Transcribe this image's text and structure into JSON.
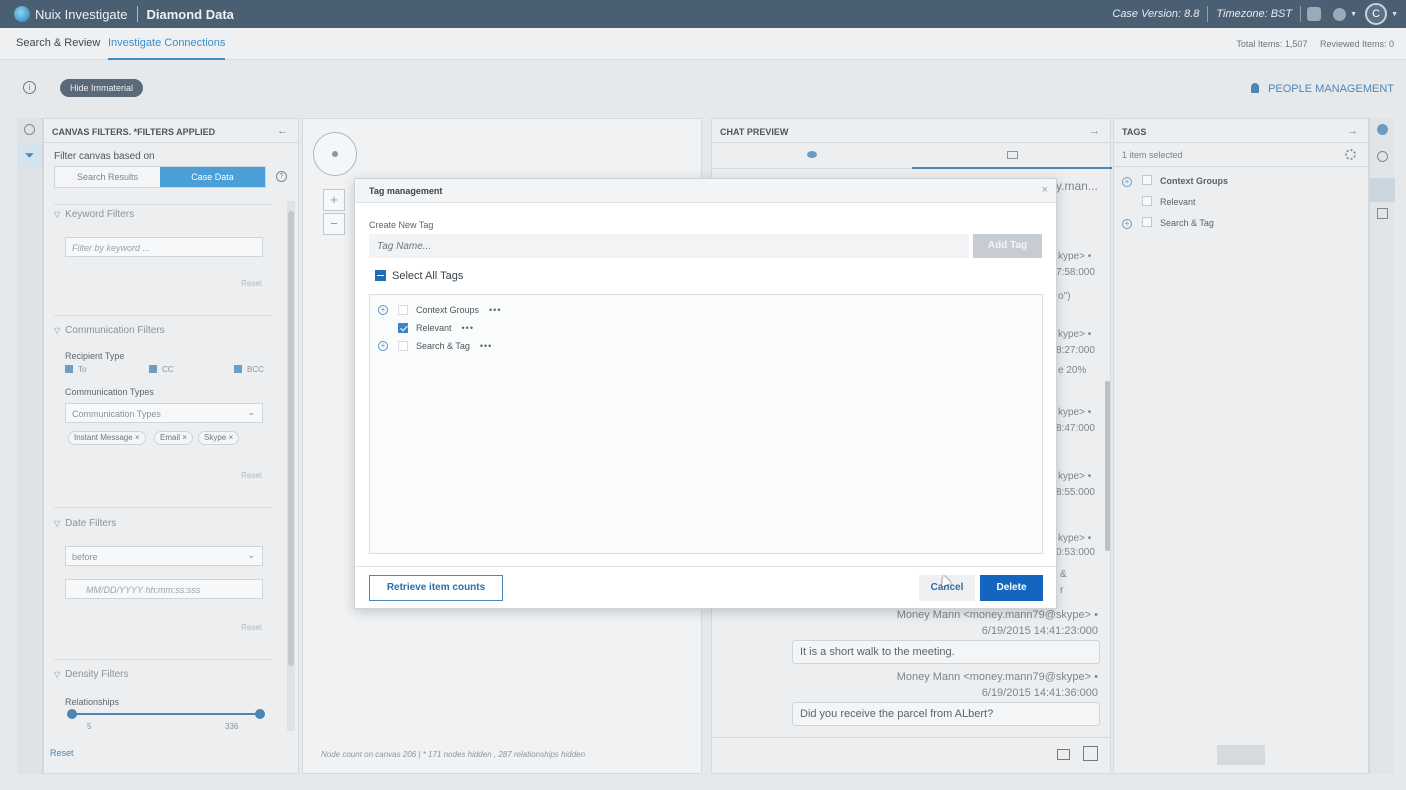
{
  "app": {
    "name": "Nuix Investigate",
    "case_name": "Diamond Data",
    "case_version": "Case Version: 8.8",
    "timezone": "Timezone: BST",
    "user_initial": "C"
  },
  "tabs": [
    {
      "label": "Search & Review"
    },
    {
      "label": "Investigate Connections",
      "active": true
    }
  ],
  "totals": {
    "total_items": "Total Items: 1,507",
    "reviewed_items": "Reviewed Items: 0"
  },
  "toolbar": {
    "hide_immaterial": "Hide Immaterial",
    "people_management": "PEOPLE MANAGEMENT"
  },
  "filters_panel": {
    "title": "CANVAS FILTERS. *FILTERS APPLIED",
    "filter_based_on": "Filter canvas based on",
    "segments": [
      "Search Results",
      "Case Data"
    ],
    "keyword_section": "Keyword Filters",
    "keyword_placeholder": "Filter by keyword ...",
    "reset": "Reset",
    "communication_section": "Communication Filters",
    "recipient_type": "Recipient Type",
    "recipients": [
      "To",
      "CC",
      "BCC"
    ],
    "communication_types_label": "Communication Types",
    "communication_types_placeholder": "Communication Types",
    "chips": [
      "Instant Message ×",
      "Email ×",
      "Skype ×"
    ],
    "date_section": "Date Filters",
    "date_mode": "before",
    "date_placeholder": "MM/DD/YYYY hh:mm:ss:sss",
    "density_section": "Density Filters",
    "relationships": "Relationships",
    "slider_min": "5",
    "slider_max": "336",
    "footer_reset": "Reset"
  },
  "canvas": {
    "zoom_in": "+",
    "zoom_out": "−",
    "footer": "Node count on canvas 206 | * 171 nodes hidden , 287 relationships hidden"
  },
  "chat_preview": {
    "title": "CHAT PREVIEW",
    "fragments": [
      "y.man...",
      "kype> •",
      "7:58:000",
      "o\")",
      "kype> •",
      "8:27:000",
      "e 20%",
      "kype> •",
      "8:47:000",
      "kype> •",
      "8:55:000",
      "kype> •",
      "0:53:000",
      "&",
      "r"
    ],
    "messages": [
      {
        "sender": "Money Mann <money.mann79@skype> •",
        "time": "6/19/2015 14:41:23:000",
        "text": "It is a short walk to the meeting."
      },
      {
        "sender": "Money Mann <money.mann79@skype> •",
        "time": "6/19/2015 14:41:36:000",
        "text": "Did you receive the parcel from ALbert?"
      }
    ]
  },
  "tags_panel": {
    "title": "TAGS",
    "selected": "1 item selected",
    "items": [
      "Context Groups",
      "Relevant",
      "Search & Tag"
    ]
  },
  "modal": {
    "title": "Tag management",
    "create_label": "Create New Tag",
    "tag_name_placeholder": "Tag Name...",
    "add_tag": "Add Tag",
    "select_all": "Select All Tags",
    "tags": [
      {
        "name": "Context Groups",
        "more": "•••"
      },
      {
        "name": "Relevant",
        "more": "•••"
      },
      {
        "name": "Search & Tag",
        "more": "•••"
      }
    ],
    "retrieve_counts": "Retrieve item counts",
    "cancel": "Cancel",
    "delete": "Delete"
  }
}
